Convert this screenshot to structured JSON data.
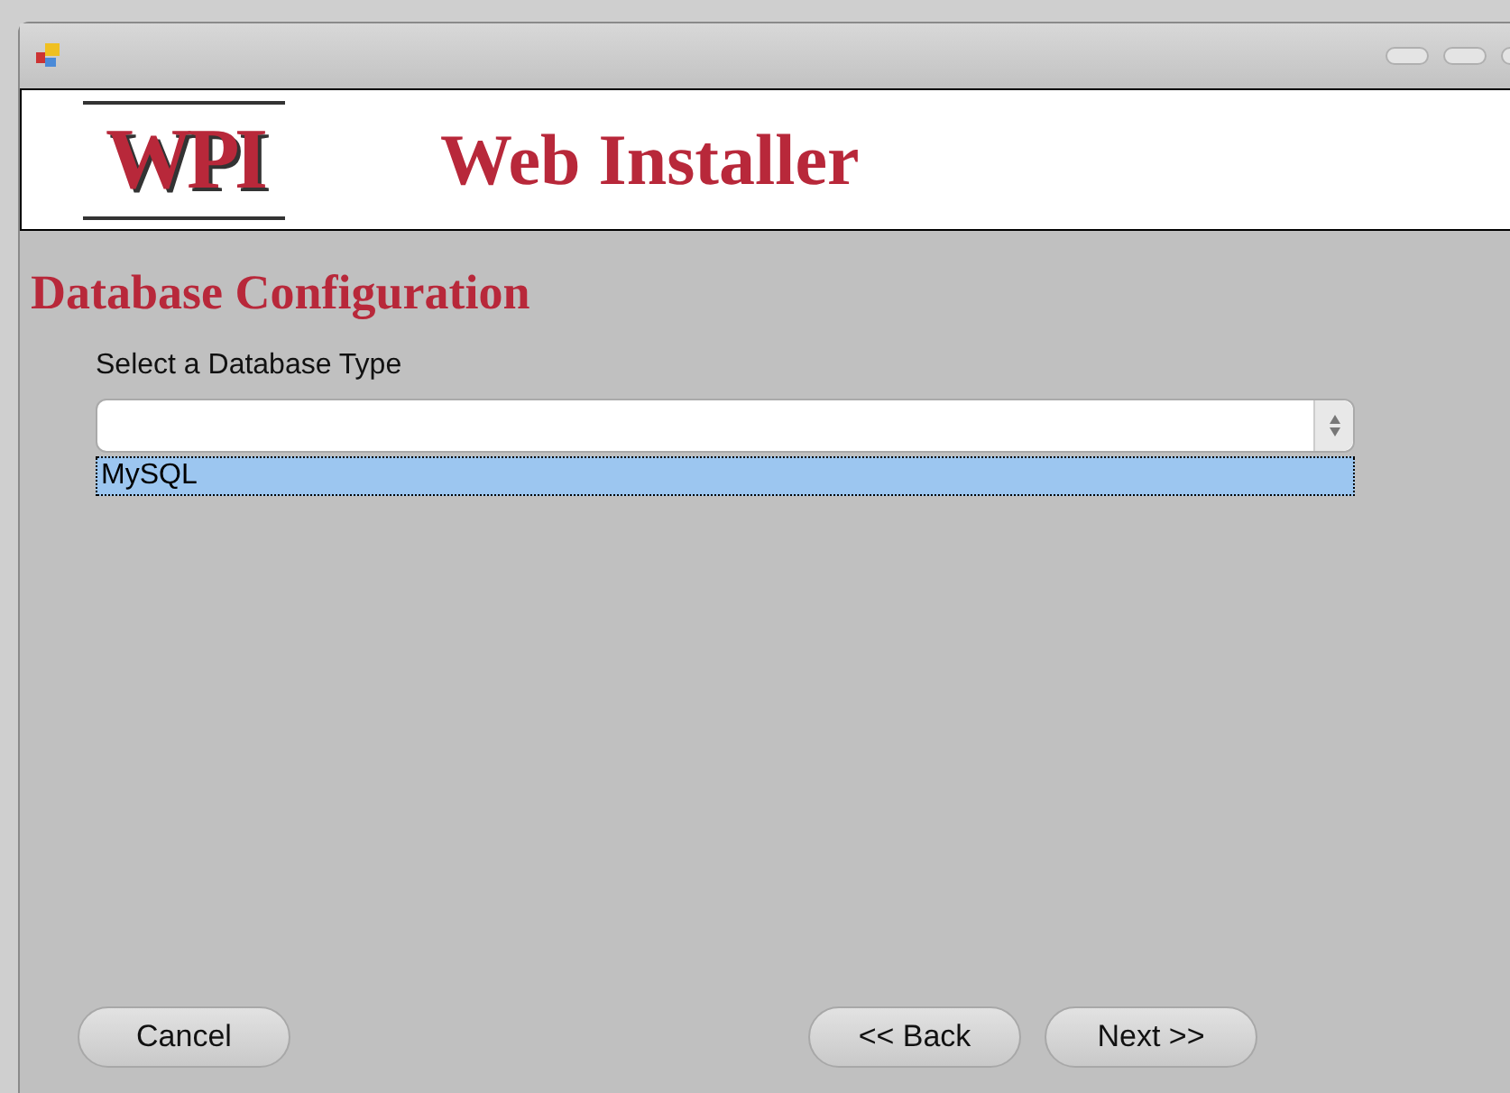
{
  "banner": {
    "logo": "WPI",
    "title": "Web Installer"
  },
  "heading": "Database Configuration",
  "database_type": {
    "label": "Select a Database Type",
    "options": [
      {
        "label": "MySQL",
        "selected": true
      }
    ]
  },
  "buttons": [
    {
      "label": "Cancel",
      "kind": "left"
    },
    {
      "label": "<< Back",
      "kind": "right"
    },
    {
      "label": "Next >>",
      "kind": "right"
    }
  ]
}
